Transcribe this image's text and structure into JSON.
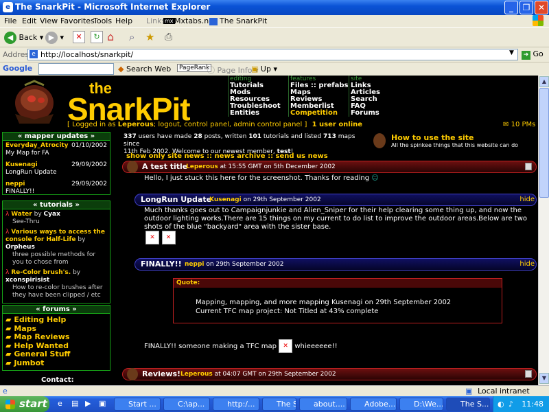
{
  "window": {
    "title": "The SnarkPit - Microsoft Internet Explorer"
  },
  "menu": [
    "File",
    "Edit",
    "View",
    "Favorites",
    "Tools",
    "Help"
  ],
  "links_bar": {
    "label": "Links",
    "items": [
      "Mxtabs.net",
      "The SnarkPit"
    ]
  },
  "toolbar": {
    "back": "Back"
  },
  "address": {
    "label": "Address",
    "url": "http://localhost/snarkpit/",
    "go": "Go"
  },
  "google": {
    "label": "Google",
    "search_web": "Search Web",
    "pagerank": "PageRank",
    "page_info": "Page Info",
    "up": "Up"
  },
  "site": {
    "logo_small": "the",
    "logo_big": "SnarkPit",
    "nav": {
      "editing": {
        "label": "editing",
        "items": [
          "Tutorials",
          "Mods",
          "Resources",
          "Troubleshoot",
          "Entities"
        ]
      },
      "features": {
        "label": "features",
        "items": [
          "Files :: prefabs",
          "Maps",
          "Reviews",
          "Memberlist",
          "Competition"
        ]
      },
      "site": {
        "label": "site",
        "items": [
          "Links",
          "Articles",
          "Search",
          "FAQ",
          "Forums"
        ]
      }
    },
    "login": {
      "open": "[ Logged in as",
      "user": "Leperous",
      "rest": "; logout, control panel, admin control panel ]",
      "online": "1 user online",
      "pms": "10 PMs"
    },
    "stats": {
      "pre": "users have made",
      "users": "337",
      "posts": "28",
      "posts_suffix": "posts, written",
      "tutorials": "101",
      "tut_suffix": "tutorials and listed",
      "maps": "713",
      "maps_suffix": "maps since",
      "line2": "11th Feb 2002. Welcome to our newest member,",
      "newest": "test",
      "end": "!"
    },
    "howto": {
      "title": "How to use the site",
      "sub": "All the spinkee things that this website can do"
    },
    "news_links": "show only site news :: news archive :: send us news",
    "mapper_updates": {
      "header": "« mapper updates »",
      "items": [
        {
          "user": "Everyday_Atrocity",
          "date": "01/10/2002",
          "text": "My Map for FA"
        },
        {
          "user": "Kusenagi",
          "date": "29/09/2002",
          "text": "LongRun Update"
        },
        {
          "user": "neppi",
          "date": "29/09/2002",
          "text": "FINALLY!!"
        }
      ]
    },
    "tutorials": {
      "header": "« tutorials »",
      "items": [
        {
          "title": "Water",
          "by": "by",
          "author": "Cyax",
          "desc": "See-Thru"
        },
        {
          "title": "Various ways to access the console for Half-Life",
          "by": "by",
          "author": "Orpheus",
          "desc": "three possible methods for you to chose from"
        },
        {
          "title": "Re-Color brush's.",
          "by": "by",
          "author": "xconspirisist",
          "desc": "How to re-color brushes after they have been clipped / etc"
        }
      ]
    },
    "forums": {
      "header": "« forums »",
      "items": [
        "Editing Help",
        "Maps",
        "Map Reviews",
        "Help Wanted",
        "General Stuff",
        "Jumbot"
      ]
    },
    "contact": "Contact:",
    "news": [
      {
        "title": "A test title",
        "author": "Leperous",
        "meta": "at 15:55 GMT on 5th December 2002",
        "body": "Hello, I just stuck this here for the screenshot. Thanks for reading"
      },
      {
        "title": "LongRun Update",
        "author": "Kusenagi",
        "meta": "on 29th September 2002",
        "hide": "hide",
        "body": "Much thanks goes out to Campaignjunkie and Alien_Sniper for their help clearing some thing up, and now the outdoor lighting works.There are 15 things on my current to do list to improve the outdoor areas.Below are two shots of the blue \"backyard\" area with the sister base."
      },
      {
        "title": "FINALLY!!",
        "author": "neppi",
        "meta": "on 29th September 2002",
        "hide": "hide",
        "quote_label": "Quote:",
        "quote_line1": "Mapping, mapping, and more mapping Kusenagi on 29th September 2002",
        "quote_line2": "Current TFC map project: Not Titled at 43% complete",
        "body_pre": "FINALLY!! someone making a TFC map",
        "body_post": "whieeeeee!!"
      },
      {
        "title": "Reviews!",
        "author": "Leperous",
        "meta": "at 04:07 GMT on 29th September 2002"
      }
    ]
  },
  "status": {
    "zone": "Local intranet"
  },
  "taskbar": {
    "start": "start",
    "tasks": [
      "Start ...",
      "C:\\ap...",
      "http:/...",
      "The S...",
      "about....",
      "Adobe...",
      "D:\\We...",
      "The S..."
    ],
    "clock": "11:48"
  }
}
